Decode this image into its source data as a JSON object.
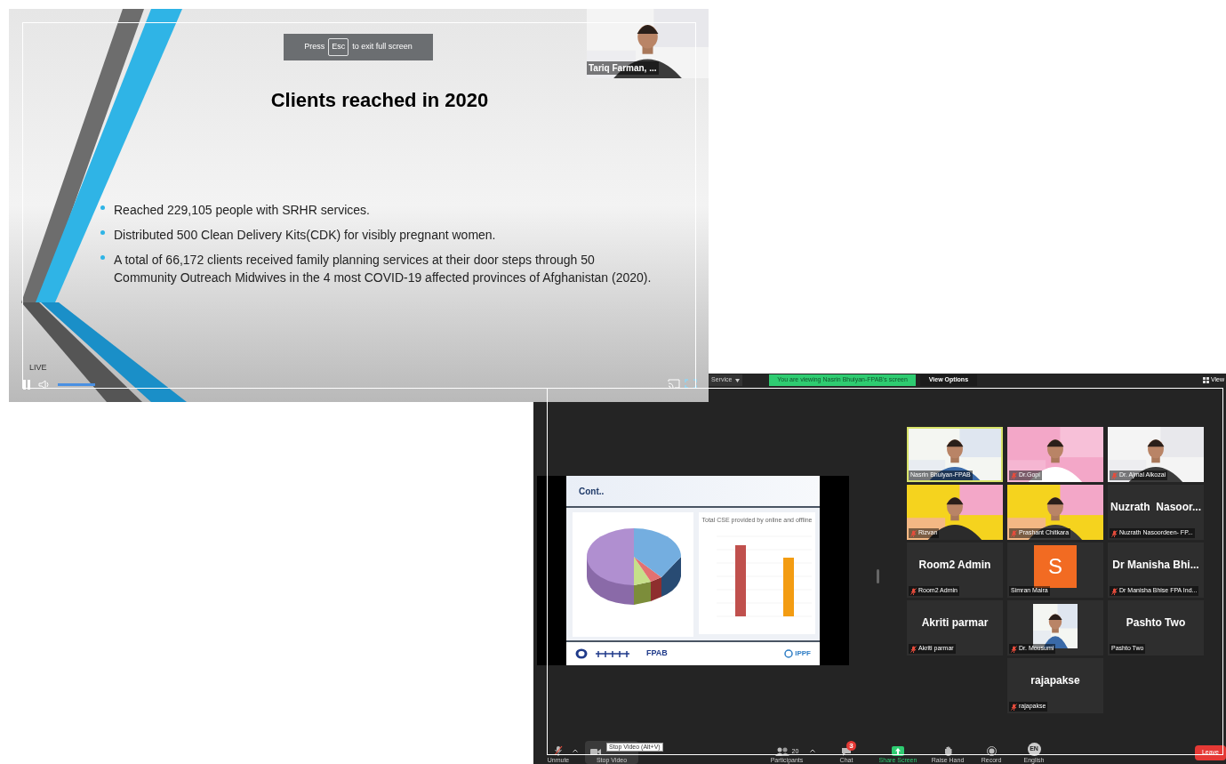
{
  "fullscreen_viewer": {
    "exit_hint": {
      "prefix": "Press",
      "key": "Esc",
      "suffix": "to exit full screen"
    },
    "speaker_thumbnail": {
      "kind": "picture",
      "name": "Tariq Farman, ..."
    },
    "slide": {
      "title": "Clients reached in 2020",
      "bullets": [
        "Reached 229,105 people with SRHR services.",
        "Distributed 500 Clean Delivery Kits(CDK) for visibly pregnant women.",
        "A total of 66,172 clients received family planning services at their door steps through 50 Community Outreach Midwives in the 4 most COVID-19 affected provinces of Afghanistan (2020)."
      ]
    },
    "player": {
      "live_label": "LIVE",
      "volume": {
        "level": 1
      }
    }
  },
  "meeting_window": {
    "top_bar": {
      "menu_label": "Service",
      "banner": "You are viewing Nasrin Bhuiyan-FPAB's screen",
      "view_options": "View Options",
      "view": "View"
    },
    "shared_slide": {
      "title": "Cont..",
      "bar_chart": {
        "title": "Total CSE provided by online and offline"
      },
      "footer": {
        "org": "FPAB",
        "partner": "IPPF"
      }
    },
    "participants": [
      {
        "kind": "video",
        "name": "Nasrin Bhuiyan-FPAB",
        "muted": false,
        "speaking": true
      },
      {
        "kind": "video",
        "name": "Dr.Gopi",
        "muted": true,
        "speaking": false
      },
      {
        "kind": "video",
        "name": "Dr. Ajmal Alkozai",
        "muted": true,
        "speaking": false
      },
      {
        "kind": "video",
        "name": "Rizvan",
        "muted": true,
        "speaking": false
      },
      {
        "kind": "video",
        "name": "Prashant Chitkara",
        "muted": true,
        "speaking": false
      },
      {
        "kind": "name",
        "display": "Nuzrath  Nasoor...",
        "name": "Nuzrath Nasoordeen- FP...",
        "muted": true,
        "speaking": false
      },
      {
        "kind": "name",
        "display": "Room2 Admin",
        "name": "Room2 Admin",
        "muted": true,
        "speaking": false
      },
      {
        "kind": "avatar",
        "letter": "S",
        "name": "Simran Maira",
        "muted": false,
        "speaking": false
      },
      {
        "kind": "name",
        "display": "Dr Manisha Bhi...",
        "name": "Dr Manisha Bhise FPA Ind...",
        "muted": true,
        "speaking": false
      },
      {
        "kind": "name",
        "display": "Akriti parmar",
        "name": "Akriti parmar",
        "muted": true,
        "speaking": false
      },
      {
        "kind": "portrait",
        "name": "Dr. Mousumi",
        "muted": true,
        "speaking": false
      },
      {
        "kind": "name",
        "display": "Pashto Two",
        "name": "Pashto Two",
        "muted": false,
        "speaking": false
      },
      {
        "kind": "name",
        "display": "rajapakse",
        "name": "rajapakse",
        "muted": true,
        "speaking": false
      }
    ],
    "toolbar": {
      "unmute": "Unmute",
      "stop_video": {
        "label": "Stop Video",
        "hovered": true,
        "tooltip": "Stop Video (Alt+V)"
      },
      "participants": {
        "label": "Participants",
        "count": "20"
      },
      "chat": {
        "label": "Chat",
        "badge": "3"
      },
      "share_screen": "Share Screen",
      "raise_hand": "Raise Hand",
      "record": "Record",
      "language": {
        "label": "English",
        "code": "EN"
      },
      "leave": "Leave"
    }
  }
}
